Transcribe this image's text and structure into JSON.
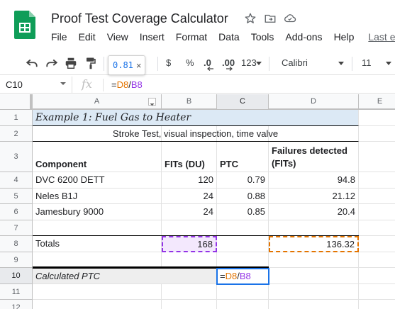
{
  "doc": {
    "title": "Proof Test Coverage Calculator"
  },
  "menu": {
    "items": [
      "File",
      "Edit",
      "View",
      "Insert",
      "Format",
      "Data",
      "Tools",
      "Add-ons",
      "Help"
    ],
    "last_edit": "Last ed"
  },
  "toolbar": {
    "zoom_tip": "0.81",
    "currency": "$",
    "percent": "%",
    "dec_less": ".0",
    "dec_more": ".00",
    "more_formats": "123",
    "font": "Calibri",
    "font_size": "11"
  },
  "formula_bar": {
    "name_box": "C10",
    "fx": "fx",
    "formula_prefix": "=",
    "formula_ref1": "D8",
    "formula_div": "/",
    "formula_ref2": "B8"
  },
  "columns": [
    "A",
    "B",
    "C",
    "D",
    "E"
  ],
  "rows": [
    "1",
    "2",
    "3",
    "4",
    "5",
    "6",
    "7",
    "8",
    "9",
    "10",
    "11",
    "12"
  ],
  "sheet": {
    "a1": "Example 1: Fuel Gas to Heater",
    "b2": "Stroke Test, visual inspection, time valve",
    "headers": {
      "component": "Component",
      "fits": "FITs (DU)",
      "ptc": "PTC",
      "failures_l1": "Failures detected",
      "failures_l2": "(FITs)"
    },
    "data_rows": [
      {
        "component": "DVC 6200 DETT",
        "fits": "120",
        "ptc": "0.79",
        "failures": "94.8"
      },
      {
        "component": "Neles B1J",
        "fits": "24",
        "ptc": "0.88",
        "failures": "21.12"
      },
      {
        "component": "Jamesbury 9000",
        "fits": "24",
        "ptc": "0.85",
        "failures": "20.4"
      }
    ],
    "totals": {
      "label": "Totals",
      "fits": "168",
      "failures": "136.32"
    },
    "calc": {
      "label": "Calculated PTC",
      "edit_prefix": "=",
      "edit_ref1": "D8",
      "edit_div": "/",
      "edit_ref2": "B8"
    }
  },
  "colors": {
    "accent_blue": "#1a73e8",
    "ref_orange": "#e37400",
    "ref_purple": "#9334e6",
    "title_fill": "#dce9f5",
    "purple_fill": "#f3e8fd",
    "calc_fill": "#eeeeee"
  }
}
